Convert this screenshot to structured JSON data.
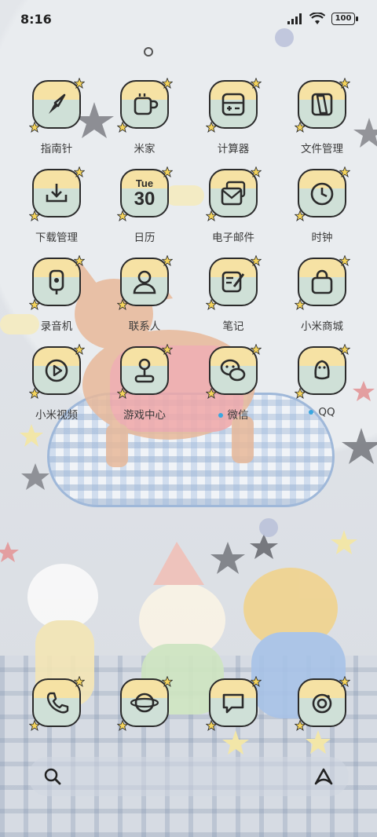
{
  "status_bar": {
    "time": "8:16",
    "battery": "100"
  },
  "apps": [
    {
      "label": "指南针",
      "icon": "compass-icon"
    },
    {
      "label": "米家",
      "icon": "mijia-cup-icon"
    },
    {
      "label": "计算器",
      "icon": "calculator-icon"
    },
    {
      "label": "文件管理",
      "icon": "folder-icon"
    },
    {
      "label": "下载管理",
      "icon": "download-icon"
    },
    {
      "label": "日历",
      "icon": "calendar-icon",
      "day_of_week": "Tue",
      "day": "30"
    },
    {
      "label": "电子邮件",
      "icon": "mail-icon"
    },
    {
      "label": "时钟",
      "icon": "clock-icon"
    },
    {
      "label": "录音机",
      "icon": "recorder-icon"
    },
    {
      "label": "联系人",
      "icon": "contacts-icon"
    },
    {
      "label": "笔记",
      "icon": "notes-icon"
    },
    {
      "label": "小米商城",
      "icon": "shopping-bag-icon"
    },
    {
      "label": "小米视频",
      "icon": "video-play-icon"
    },
    {
      "label": "游戏中心",
      "icon": "joystick-icon"
    },
    {
      "label": "微信",
      "icon": "wechat-icon",
      "new_dot": true
    },
    {
      "label": "QQ",
      "icon": "qq-penguin-icon",
      "new_dot": true
    }
  ],
  "dock": [
    {
      "icon": "phone-icon"
    },
    {
      "icon": "browser-planet-icon"
    },
    {
      "icon": "messages-icon"
    },
    {
      "icon": "camera-icon"
    }
  ],
  "search_bar": {
    "search_icon": "search-icon",
    "assistant_icon": "xiaoai-icon"
  },
  "colors": {
    "tile_top": "#f6e2a4",
    "tile_bottom": "#cfe0d7",
    "star": "#f5d45c",
    "outline": "#2b2b2b",
    "dot": "#39a7e0"
  }
}
